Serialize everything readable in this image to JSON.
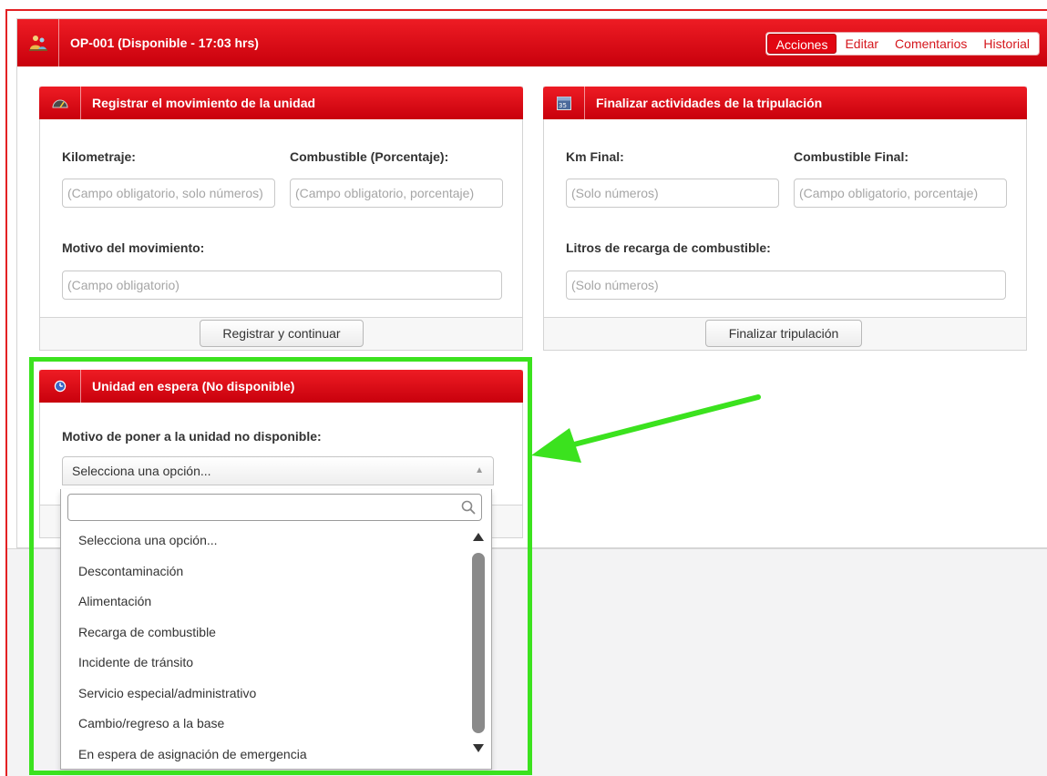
{
  "header": {
    "title": "OP-001 (Disponible - 17:03 hrs)",
    "tabs": [
      {
        "label": "Acciones",
        "active": true
      },
      {
        "label": "Editar"
      },
      {
        "label": "Comentarios"
      },
      {
        "label": "Historial"
      }
    ]
  },
  "movement_panel": {
    "title": "Registrar el movimiento de la unidad",
    "km_label": "Kilometraje:",
    "km_placeholder": "(Campo obligatorio, solo números)",
    "fuel_label": "Combustible (Porcentaje):",
    "fuel_placeholder": "(Campo obligatorio, porcentaje)",
    "reason_label": "Motivo del movimiento:",
    "reason_placeholder": "(Campo obligatorio)",
    "submit_label": "Registrar y continuar"
  },
  "crew_panel": {
    "title": "Finalizar actividades de la tripulación",
    "km_label": "Km Final:",
    "km_placeholder": "(Solo números)",
    "fuel_label": "Combustible Final:",
    "fuel_placeholder": "(Campo obligatorio, porcentaje)",
    "liters_label": "Litros de recarga de combustible:",
    "liters_placeholder": "(Solo números)",
    "submit_label": "Finalizar tripulación"
  },
  "standby_panel": {
    "title": "Unidad en espera (No disponible)",
    "reason_label": "Motivo de poner a la unidad no disponible:",
    "selected_value": "Selecciona una opción...",
    "options": [
      "Selecciona una opción...",
      "Descontaminación",
      "Alimentación",
      "Recarga de combustible",
      "Incidente de tránsito",
      "Servicio especial/administrativo",
      "Cambio/regreso a la base",
      "En espera de asignación de emergencia"
    ]
  },
  "colors": {
    "brand_red": "#e20612",
    "highlight_green": "#3be21e"
  },
  "icons": {
    "header": "people-icon",
    "movement": "odometer-icon",
    "crew": "calendar-icon",
    "standby": "clock-icon"
  }
}
